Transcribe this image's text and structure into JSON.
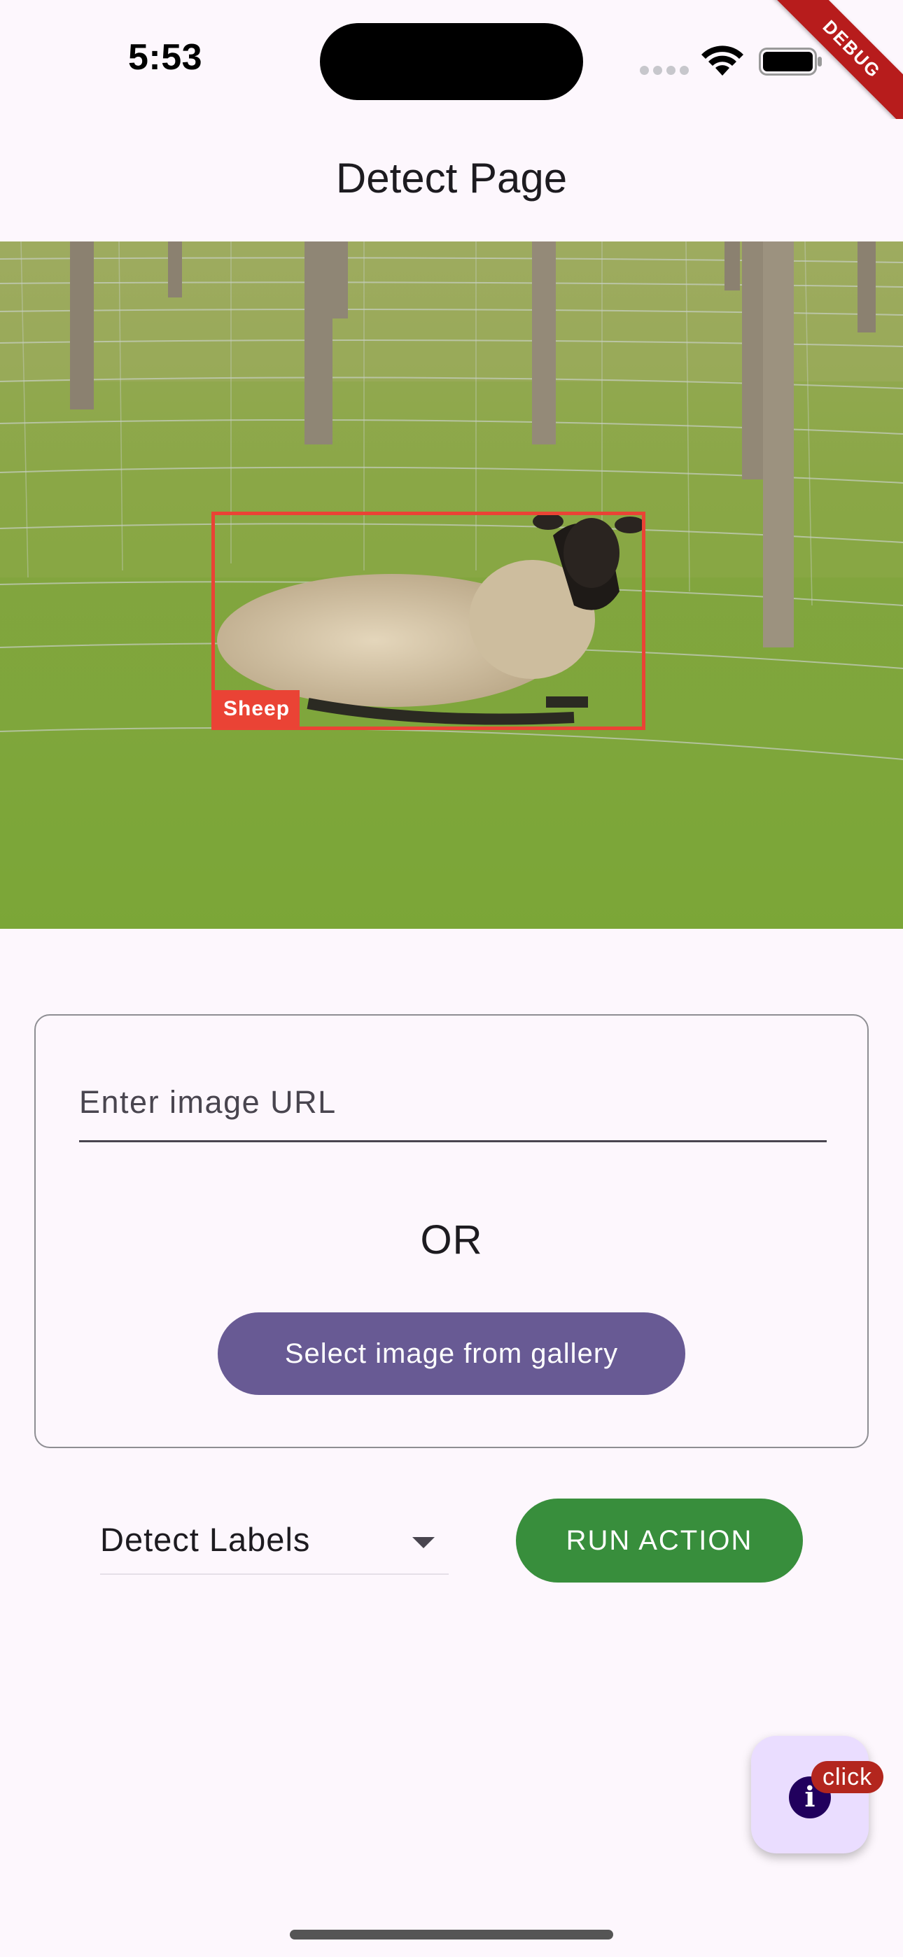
{
  "status_bar": {
    "time": "5:53"
  },
  "debug_banner": "DEBUG",
  "app_bar": {
    "title": "Detect Page"
  },
  "detection": {
    "label": "Sheep"
  },
  "input_card": {
    "url_placeholder": "Enter image URL",
    "or_text": "OR",
    "gallery_button": "Select image from gallery"
  },
  "controls": {
    "dropdown_value": "Detect Labels",
    "run_button": "RUN ACTION"
  },
  "fab": {
    "icon": "info-icon",
    "badge": "click"
  },
  "colors": {
    "accent_purple": "#685a94",
    "run_green": "#388e3c",
    "detect_red": "#ea4335",
    "fab_bg": "#eaddff",
    "badge_red": "#b3261e"
  }
}
